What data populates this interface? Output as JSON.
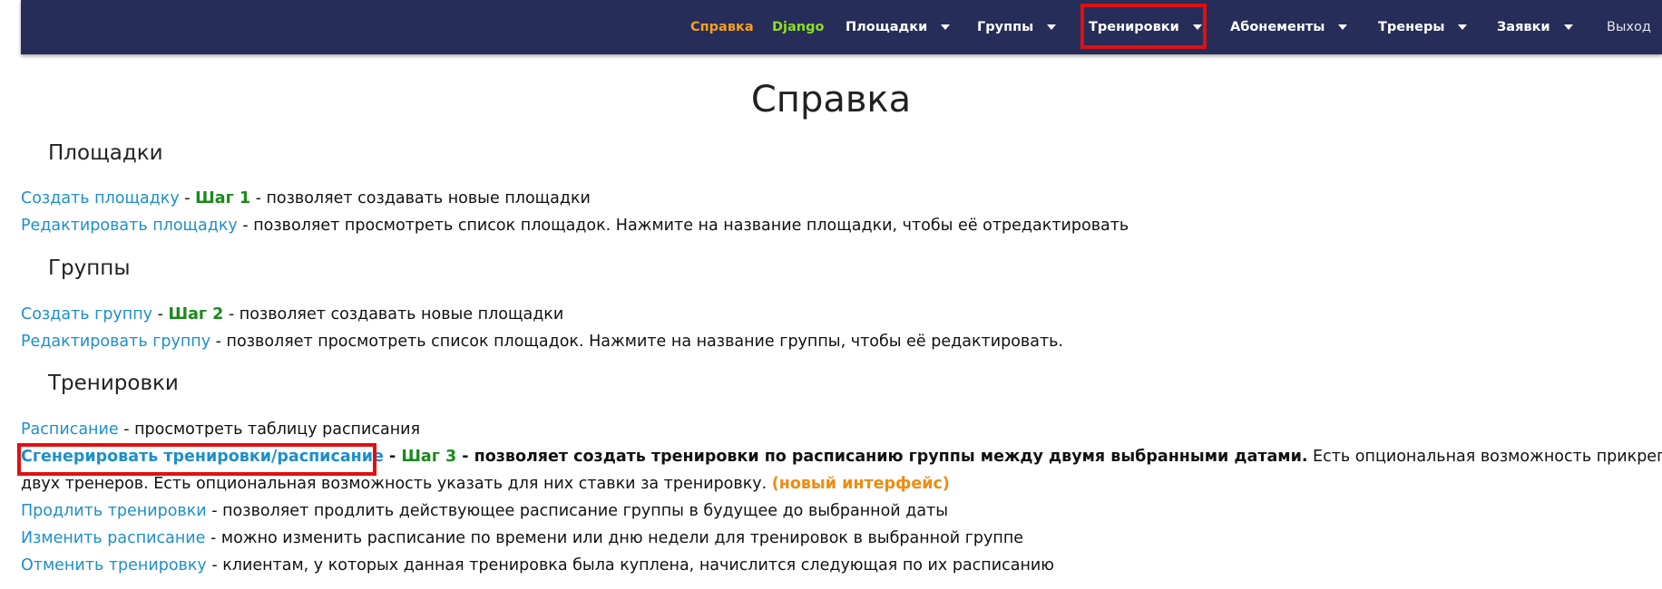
{
  "navbar": {
    "help": "Справка",
    "django": "Django",
    "venues": "Площадки",
    "groups": "Группы",
    "trainings": "Тренировки",
    "subscriptions": "Абонементы",
    "coaches": "Тренеры",
    "requests": "Заявки",
    "logout": "Выход"
  },
  "page_title": "Справка",
  "sections": {
    "venues": {
      "title": "Площадки",
      "create_link": "Создать площадку",
      "create_step": "Шаг 1",
      "create_desc": " - позволяет создавать новые площадки",
      "edit_link": "Редактировать площадку",
      "edit_desc": " - позволяет просмотреть список площадок. Нажмите на название площадки, чтобы её отредактировать"
    },
    "groups": {
      "title": "Группы",
      "create_link": "Создать группу",
      "create_step": "Шаг 2",
      "create_desc": " - позволяет создавать новые площадки",
      "edit_link": "Редактировать группу",
      "edit_desc": " - позволяет просмотреть список площадок. Нажмите на название группы, чтобы её редактировать."
    },
    "trainings": {
      "title": "Тренировки",
      "schedule_link": "Расписание",
      "schedule_desc": " - просмотреть таблицу расписания",
      "generate_link": "Сгенерировать тренировки/расписание",
      "generate_step": "Шаг 3",
      "generate_bold": " - позволяет создать тренировки по расписанию группы между двумя выбранными датами.",
      "generate_desc": " Есть опциональная возможность прикрепить",
      "generate_desc2": "двух тренеров. Есть опциональная возможность указать для них ставки за тренировку. ",
      "new_interface": "(новый интерфейс)",
      "extend_link": "Продлить тренировки",
      "extend_desc": " - позволяет продлить действующее расписание группы в будущее до выбранной даты",
      "change_link": "Изменить расписание",
      "change_desc": " - можно изменить расписание по времени или дню недели для тренировок в выбранной группе",
      "cancel_link": "Отменить тренировку",
      "cancel_desc": " - клиентам, у которых данная тренировка была куплена, начислится следующая по их расписанию"
    }
  }
}
